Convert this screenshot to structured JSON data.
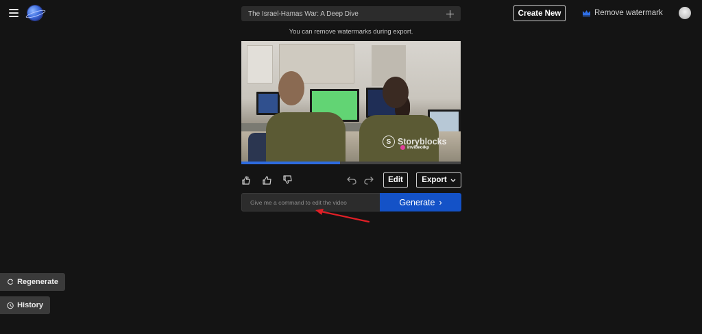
{
  "header": {
    "project_title": "The Israel-Hamas War: A Deep Dive",
    "notice": "You can remove watermarks during export.",
    "create_new_label": "Create New",
    "remove_watermark_label": "Remove watermark",
    "icons": [
      "menu-icon",
      "logo",
      "plus-icon",
      "crown-icon",
      "avatar"
    ],
    "accent_color": "#1452c7"
  },
  "video": {
    "watermark_brand": "Storyblocks",
    "watermark_tag": "invideo/kp",
    "progress_percent": 45
  },
  "controls": {
    "edit_label": "Edit",
    "export_label": "Export",
    "icons": [
      "thumbs-up-double-icon",
      "thumbs-up-icon",
      "thumbs-down-icon",
      "undo-icon",
      "redo-icon",
      "chevron-down-icon"
    ]
  },
  "command": {
    "placeholder": "Give me a command to edit the video",
    "generate_label": "Generate",
    "generate_chevron": "›"
  },
  "sidebar_bottom": {
    "regenerate_label": "Regenerate",
    "history_label": "History"
  }
}
